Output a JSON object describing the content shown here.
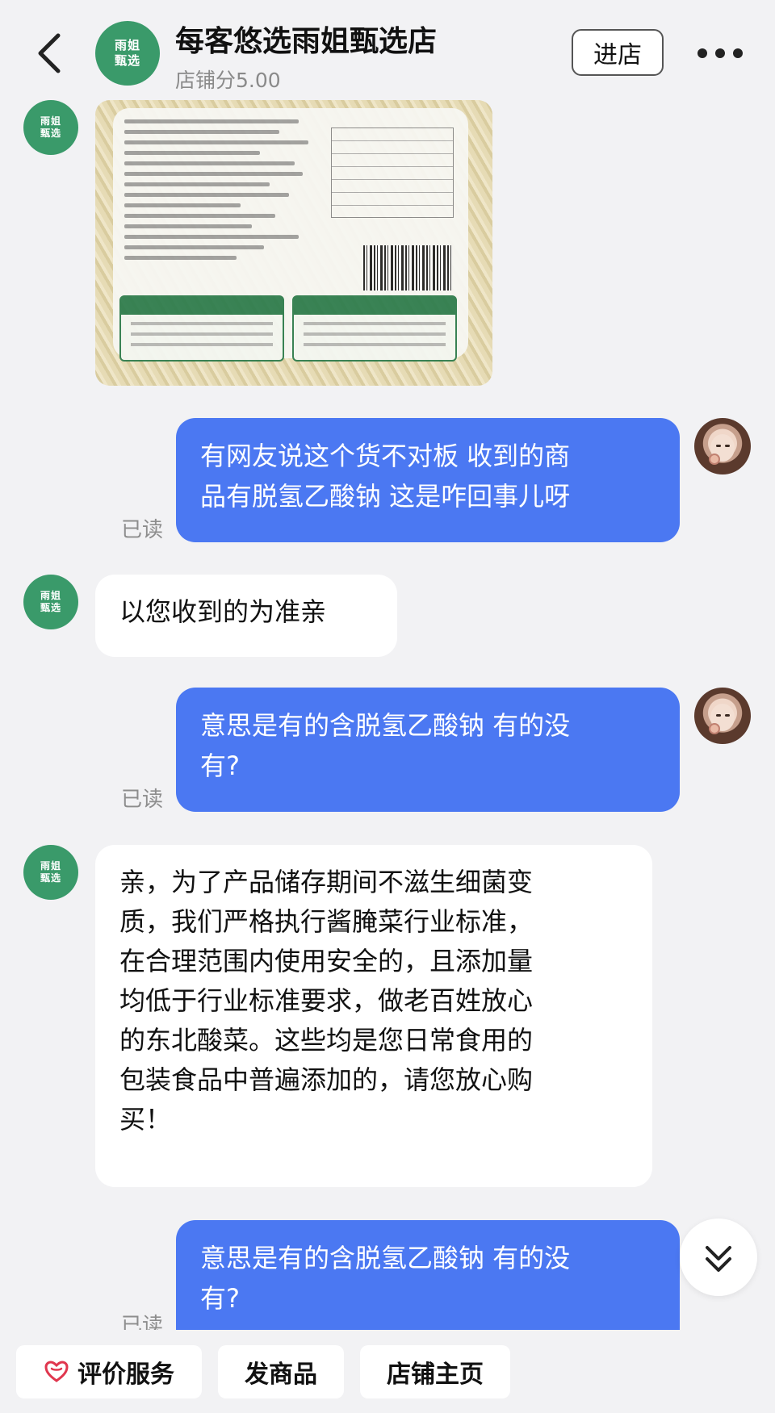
{
  "header": {
    "shop_name": "每客悠选雨姐甄选店",
    "shop_score": "店铺分5.00",
    "avatar_text": [
      "雨姐",
      "甄选"
    ],
    "enter_button": "进店"
  },
  "messages": [
    {
      "type": "image",
      "from": "shop"
    },
    {
      "type": "text",
      "from": "me",
      "lines": [
        "有网友说这个货不对板 收到的商",
        "品有脱氢乙酸钠 这是咋回事儿呀"
      ],
      "status": "已读"
    },
    {
      "type": "text",
      "from": "shop",
      "lines": [
        "以您收到的为准亲"
      ]
    },
    {
      "type": "text",
      "from": "me",
      "lines": [
        "意思是有的含脱氢乙酸钠 有的没",
        "有?"
      ],
      "status": "已读"
    },
    {
      "type": "text",
      "from": "shop",
      "lines": [
        "亲，为了产品储存期间不滋生细菌变",
        "质，我们严格执行酱腌菜行业标准，",
        "在合理范围内使用安全的，且添加量",
        "均低于行业标准要求，做老百姓放心",
        "的东北酸菜。这些均是您日常食用的",
        "包装食品中普遍添加的，请您放心购",
        "买！"
      ]
    },
    {
      "type": "text",
      "from": "me",
      "lines": [
        "意思是有的含脱氢乙酸钠 有的没",
        "有?"
      ],
      "status": "已读"
    }
  ],
  "bottom_bar": {
    "rate_service": "评价服务",
    "send_product": "发商品",
    "shop_home": "店铺主页"
  },
  "colors": {
    "my_bubble": "#4b78f2",
    "shop_avatar": "#3a9a6a",
    "background": "#f2f2f4"
  }
}
